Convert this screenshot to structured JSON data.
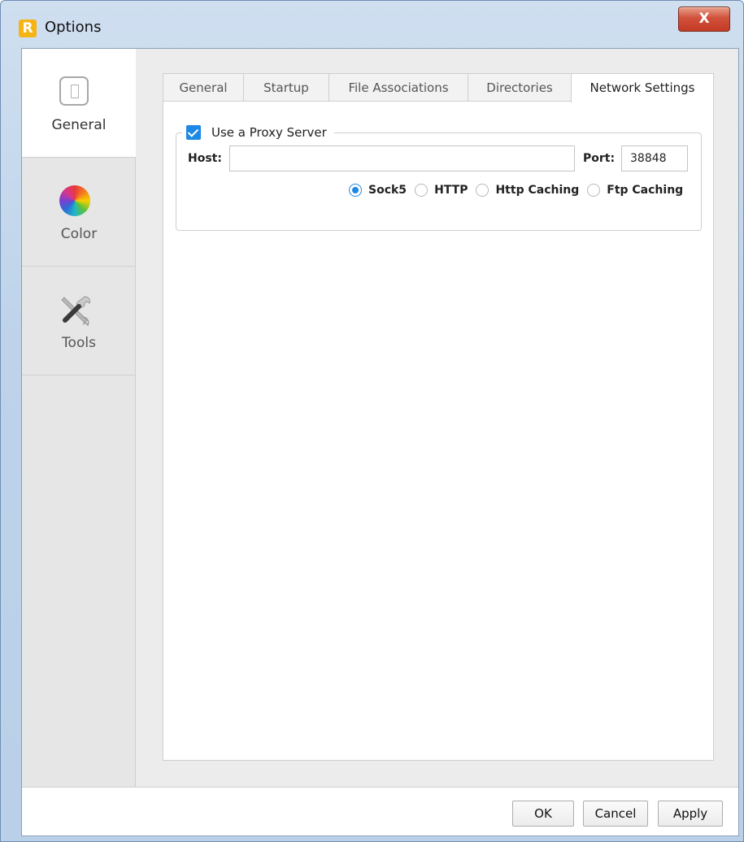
{
  "window": {
    "title": "Options",
    "logo_letter": "R",
    "close_label": "X"
  },
  "sidebar": {
    "items": [
      {
        "label": "General",
        "icon": "general-icon",
        "active": true
      },
      {
        "label": "Color",
        "icon": "color-wheel-icon",
        "active": false
      },
      {
        "label": "Tools",
        "icon": "tools-icon",
        "active": false
      }
    ]
  },
  "tabs": [
    {
      "label": "General",
      "active": false
    },
    {
      "label": "Startup",
      "active": false
    },
    {
      "label": "File Associations",
      "active": false
    },
    {
      "label": "Directories",
      "active": false
    },
    {
      "label": "Network Settings",
      "active": true
    }
  ],
  "proxy": {
    "checkbox_label": "Use a Proxy Server",
    "checked": true,
    "host_label": "Host:",
    "host_value": "",
    "port_label": "Port:",
    "port_value": "38848",
    "options": [
      {
        "label": "Sock5",
        "selected": true
      },
      {
        "label": "HTTP",
        "selected": false
      },
      {
        "label": "Http Caching",
        "selected": false
      },
      {
        "label": "Ftp Caching",
        "selected": false
      }
    ]
  },
  "buttons": {
    "ok": "OK",
    "cancel": "Cancel",
    "apply": "Apply"
  },
  "colors": {
    "accent": "#1e88e5",
    "close": "#c43b24",
    "logo": "#f6b414"
  }
}
